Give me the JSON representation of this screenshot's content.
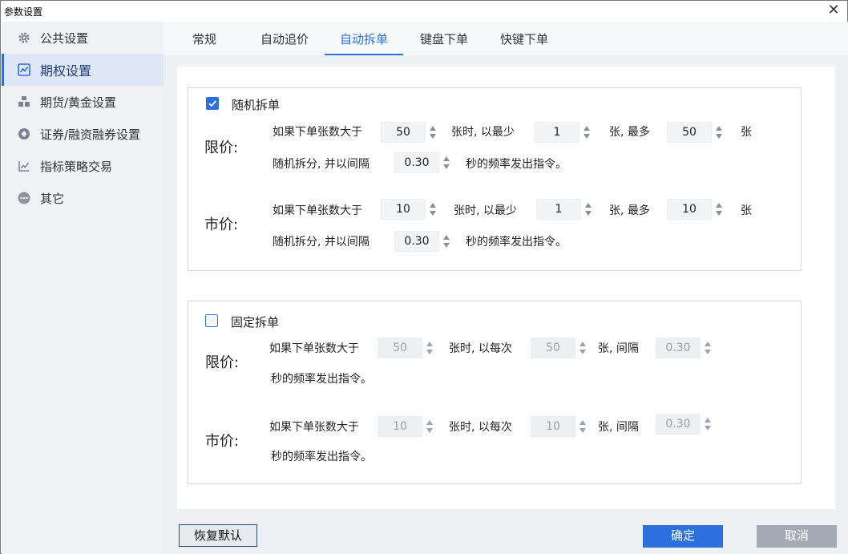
{
  "window": {
    "title": "参数设置",
    "close_glyph": "✕"
  },
  "sidebar": {
    "items": [
      {
        "label": "公共设置",
        "icon": "gear-icon"
      },
      {
        "label": "期权设置",
        "icon": "chart-icon"
      },
      {
        "label": "期货/黄金设置",
        "icon": "bars-icon"
      },
      {
        "label": "证券/融资融券设置",
        "icon": "diamond-icon"
      },
      {
        "label": "指标策略交易",
        "icon": "trend-icon"
      },
      {
        "label": "其它",
        "icon": "dots-icon"
      }
    ],
    "active_index": 1
  },
  "tabs": {
    "items": [
      "常规",
      "自动追价",
      "自动拆单",
      "键盘下单",
      "快键下单"
    ],
    "active_index": 2
  },
  "random_split": {
    "checked": true,
    "title": "随机拆单",
    "limit": {
      "label": "限价:",
      "t1": "如果下单张数大于",
      "qty": "50",
      "t2": "张时, 以最少",
      "min": "1",
      "t3": "张, 最多",
      "max": "50",
      "t4": "张",
      "t5": "随机拆分, 并以间隔",
      "interval": "0.30",
      "t6": "秒的频率发出指令。"
    },
    "market": {
      "label": "市价:",
      "t1": "如果下单张数大于",
      "qty": "10",
      "t2": "张时, 以最少",
      "min": "1",
      "t3": "张, 最多",
      "max": "10",
      "t4": "张",
      "t5": "随机拆分, 并以间隔",
      "interval": "0.30",
      "t6": "秒的频率发出指令。"
    }
  },
  "fixed_split": {
    "checked": false,
    "title": "固定拆单",
    "limit": {
      "label": "限价:",
      "t1": "如果下单张数大于",
      "qty": "50",
      "t2": "张时, 以每次",
      "each": "50",
      "t3": "张, 间隔",
      "interval": "0.30",
      "t4": "秒的频率发出指令。"
    },
    "market": {
      "label": "市价:",
      "t1": "如果下单张数大于",
      "qty": "10",
      "t2": "张时, 以每次",
      "each": "10",
      "t3": "张, 间隔",
      "interval": "0.30",
      "t4": "秒的频率发出指令。"
    }
  },
  "buttons": {
    "reset": "恢复默认",
    "ok": "确定",
    "cancel": "取消"
  },
  "colors": {
    "accent": "#2d6fdc",
    "cancel": "#a3aab6",
    "sidebar_active": "#dfe6f5"
  }
}
